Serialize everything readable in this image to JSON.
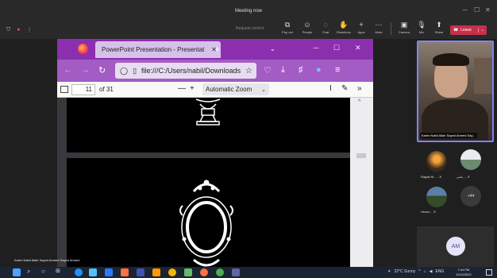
{
  "teams": {
    "meeting_title": "Meeting now",
    "request_control": "Request control",
    "toolbar": [
      {
        "label": "Pop out",
        "icon": "pop-out-icon"
      },
      {
        "label": "People",
        "icon": "people-icon"
      },
      {
        "label": "Chat",
        "icon": "chat-icon"
      },
      {
        "label": "Reactions",
        "icon": "reactions-icon"
      },
      {
        "label": "Apps",
        "icon": "apps-icon"
      },
      {
        "label": "More",
        "icon": "more-icon"
      },
      {
        "label": "Camera",
        "icon": "camera-icon"
      },
      {
        "label": "Mic",
        "icon": "mic-icon"
      },
      {
        "label": "Share",
        "icon": "share-icon"
      }
    ],
    "leave_label": "Leave",
    "accent": "#c4314b"
  },
  "browser": {
    "tab_title": "PowerPoint Presentation - Presentat",
    "url": "file:///C:/Users/nabil/Downloads/Pre",
    "page_current": "11",
    "page_total": "of 31",
    "zoom": "Automatic Zoom",
    "accent_tab": "#8b2fae",
    "accent_nav": "#a35cc4"
  },
  "participants": {
    "main_name": "Karim Nabil Allah Sayed Ahmed Say...",
    "tiles": [
      {
        "name": "Ragab M.",
        "extra": "...",
        "icon": "mic-off-icon"
      },
      {
        "name": "ياسر",
        "extra": "...",
        "icon": "mic-off-icon"
      },
      {
        "name": "Hesso...",
        "extra": "",
        "icon": "mic-off-icon"
      },
      {
        "name": "",
        "extra": "+44",
        "icon": ""
      }
    ],
    "bottom_initials": "AM"
  },
  "caption": "Karim Nabil Allah Sayed Ahmed Sayed Ahmed",
  "taskbar": {
    "weather": "22°C Sunny",
    "lang": "ENG",
    "time": "7:44 PM",
    "date": "11/10/2022"
  }
}
